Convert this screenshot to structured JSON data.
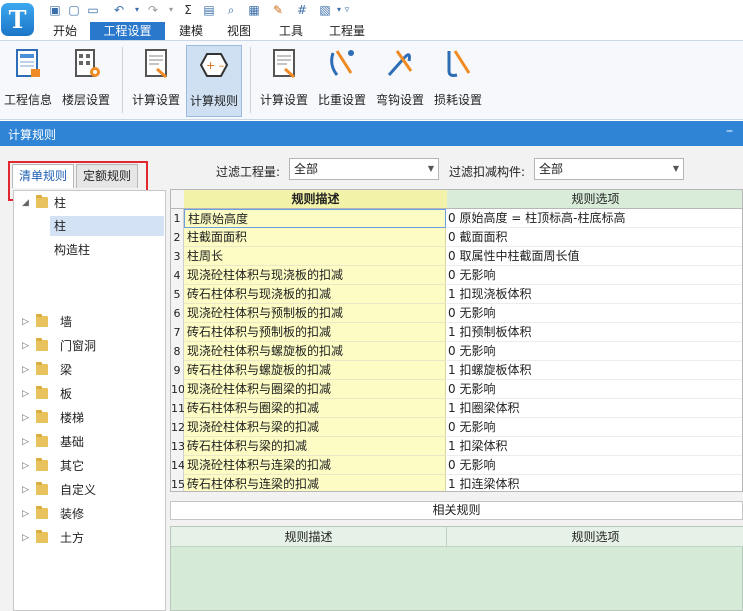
{
  "app": {
    "logo_letter": "T"
  },
  "quick_access": {
    "icons": [
      "save-icon",
      "new-icon",
      "open-icon",
      "undo-icon",
      "redo-icon",
      "sum-icon",
      "report-icon",
      "find-icon",
      "export-icon",
      "edit-icon",
      "grid-icon",
      "more-icon"
    ]
  },
  "ribbon_tabs": [
    "开始",
    "工程设置",
    "建模",
    "视图",
    "工具",
    "工程量"
  ],
  "ribbon_active_tab": "工程设置",
  "ribbon_buttons": [
    {
      "label": "工程信息",
      "icon": "project-info-icon"
    },
    {
      "label": "楼层设置",
      "icon": "floor-settings-icon"
    },
    {
      "label": "计算设置",
      "icon": "calc-settings-icon"
    },
    {
      "label": "计算规则",
      "icon": "calc-rules-icon"
    },
    {
      "label": "计算设置",
      "icon": "rebar-calc-settings-icon"
    },
    {
      "label": "比重设置",
      "icon": "density-settings-icon"
    },
    {
      "label": "弯钩设置",
      "icon": "hook-settings-icon"
    },
    {
      "label": "损耗设置",
      "icon": "loss-settings-icon"
    }
  ],
  "section": {
    "title": "计算规则",
    "minimize": "–"
  },
  "left_tabs": [
    "清单规则",
    "定额规则"
  ],
  "tree": [
    {
      "label": "柱",
      "level": 0,
      "expanded": true
    },
    {
      "label": "柱",
      "level": 1,
      "selected": true
    },
    {
      "label": "构造柱",
      "level": 1
    },
    {
      "label": "墙",
      "level": 0
    },
    {
      "label": "门窗洞",
      "level": 0
    },
    {
      "label": "梁",
      "level": 0
    },
    {
      "label": "板",
      "level": 0
    },
    {
      "label": "楼梯",
      "level": 0
    },
    {
      "label": "基础",
      "level": 0
    },
    {
      "label": "其它",
      "level": 0
    },
    {
      "label": "自定义",
      "level": 0
    },
    {
      "label": "装修",
      "level": 0
    },
    {
      "label": "土方",
      "level": 0
    }
  ],
  "filters": {
    "quantity_label": "过滤工程量:",
    "quantity_value": "全部",
    "component_label": "过滤扣减构件:",
    "component_value": "全部"
  },
  "rules_table": {
    "headers": [
      "规则描述",
      "规则选项"
    ],
    "rows": [
      {
        "n": "1",
        "desc": "柱原始高度",
        "opt": "0 原始高度 = 柱顶标高-柱底标高"
      },
      {
        "n": "2",
        "desc": "柱截面面积",
        "opt": "0 截面面积"
      },
      {
        "n": "3",
        "desc": "柱周长",
        "opt": "0 取属性中柱截面周长值"
      },
      {
        "n": "4",
        "desc": "现浇砼柱体积与现浇板的扣减",
        "opt": "0  无影响"
      },
      {
        "n": "5",
        "desc": "砖石柱体积与现浇板的扣减",
        "opt": "1 扣现浇板体积"
      },
      {
        "n": "6",
        "desc": "现浇砼柱体积与预制板的扣减",
        "opt": "0  无影响"
      },
      {
        "n": "7",
        "desc": "砖石柱体积与预制板的扣减",
        "opt": "1 扣预制板体积"
      },
      {
        "n": "8",
        "desc": "现浇砼柱体积与螺旋板的扣减",
        "opt": "0  无影响"
      },
      {
        "n": "9",
        "desc": "砖石柱体积与螺旋板的扣减",
        "opt": "1 扣螺旋板体积"
      },
      {
        "n": "10",
        "desc": "现浇砼柱体积与圈梁的扣减",
        "opt": "0  无影响"
      },
      {
        "n": "11",
        "desc": "砖石柱体积与圈梁的扣减",
        "opt": "1 扣圈梁体积"
      },
      {
        "n": "12",
        "desc": "现浇砼柱体积与梁的扣减",
        "opt": "0  无影响"
      },
      {
        "n": "13",
        "desc": "砖石柱体积与梁的扣减",
        "opt": "1 扣梁体积"
      },
      {
        "n": "14",
        "desc": "现浇砼柱体积与连梁的扣减",
        "opt": "0  无影响"
      },
      {
        "n": "15",
        "desc": "砖石柱体积与连梁的扣减",
        "opt": "1 扣连梁体积"
      }
    ]
  },
  "related": {
    "title": "相关规则",
    "headers": [
      "规则描述",
      "规则选项"
    ]
  },
  "colors": {
    "accent": "#2f84d6",
    "desc_bg": "#fcfcc4",
    "related_bg": "#d6ead8",
    "highlight": "#e0282e"
  }
}
